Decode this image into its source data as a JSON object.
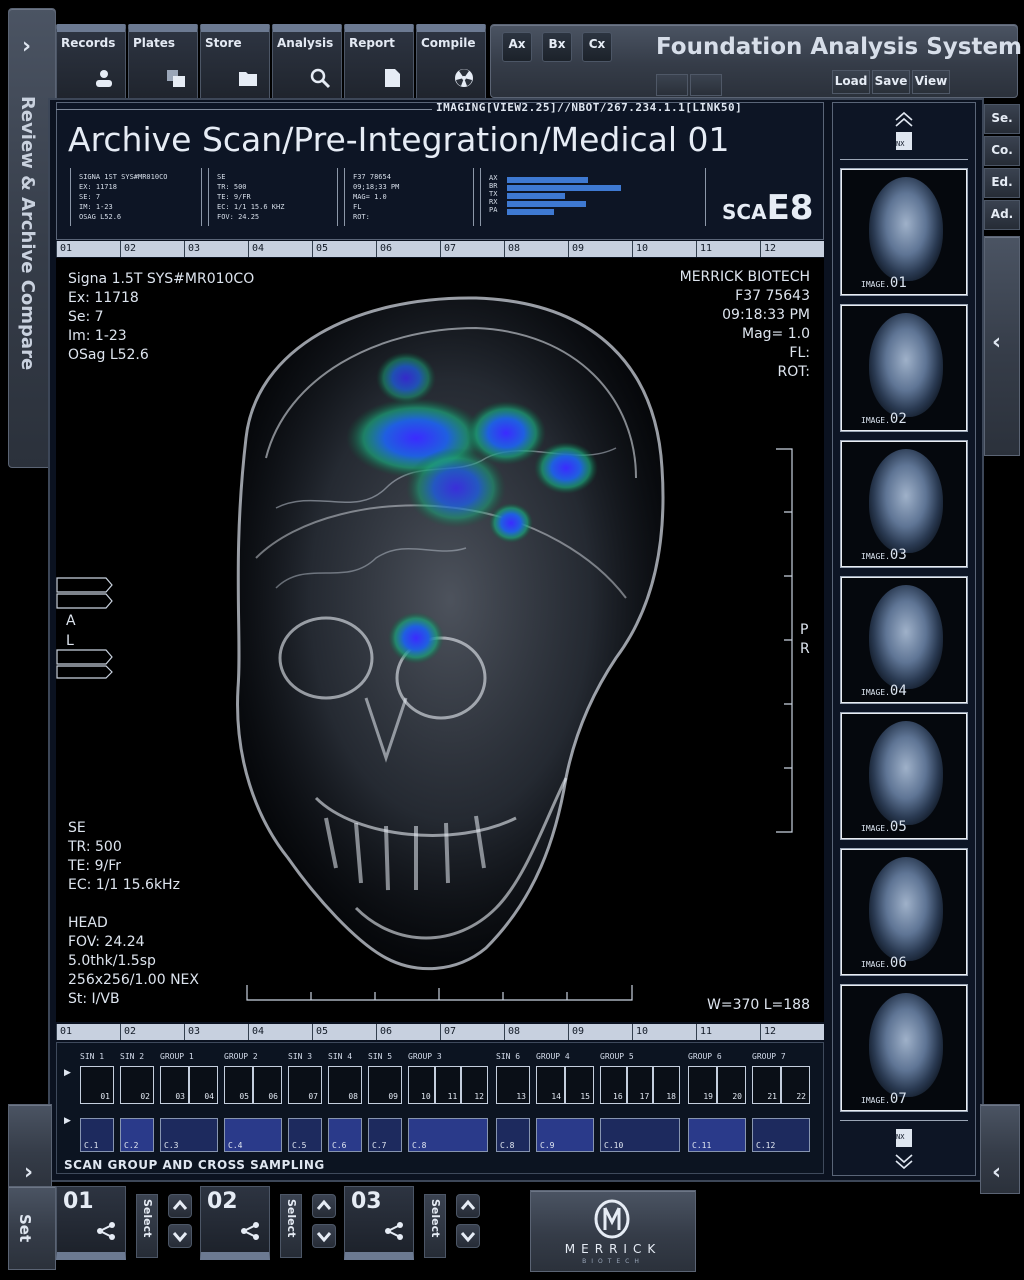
{
  "app_title": "Foundation Analysis System",
  "side_title": "Review & Archive Compare",
  "toolbar": [
    {
      "label": "Records",
      "icon": "user-icon"
    },
    {
      "label": "Plates",
      "icon": "plates-icon"
    },
    {
      "label": "Store",
      "icon": "folder-icon"
    },
    {
      "label": "Analysis",
      "icon": "magnifier-icon"
    },
    {
      "label": "Report",
      "icon": "document-icon"
    },
    {
      "label": "Compile",
      "icon": "radiation-icon"
    }
  ],
  "axis_buttons": [
    "Ax",
    "Bx",
    "Cx"
  ],
  "file_buttons": [
    "Load",
    "Save",
    "View"
  ],
  "right_side_buttons": [
    "Se.",
    "Co.",
    "Ed.",
    "Ad."
  ],
  "header": {
    "path": "IMAGING[VIEW2.25]//NBOT/267.234.1.1[LINK50]",
    "title": "Archive Scan/Pre-Integration/Medical 01",
    "block1": [
      "SIGNA 1ST SYS#MR010CO",
      "EX: 11718",
      "SE: 7",
      "IM: 1-23",
      "OSAG L52.6"
    ],
    "block2": [
      "SE",
      "TR: 500",
      "TE: 9/FR",
      "EC: 1/1 15.6 KHZ",
      "FOV: 24.25"
    ],
    "block3": [
      "F37 78654",
      "09;18;33 PM",
      "MAG= 1.0",
      "FL",
      "ROT:"
    ],
    "chart_labels": [
      "AX",
      "BR",
      "TX",
      "RX",
      "PA"
    ],
    "chart_values": [
      0.71,
      1.0,
      0.51,
      0.69,
      0.41
    ],
    "sca_label": "SCA",
    "sca_code": "E8"
  },
  "ruler_labels": [
    "01",
    "02",
    "03",
    "04",
    "05",
    "06",
    "07",
    "08",
    "09",
    "10",
    "11",
    "12"
  ],
  "overlay": {
    "top_left": [
      "Signa 1.5T SYS#MR010CO",
      "Ex: 11718",
      "Se: 7",
      "Im: 1-23",
      "OSag  L52.6"
    ],
    "top_right": [
      "MERRICK BIOTECH",
      "F37 75643",
      "09:18:33 PM",
      "Mag= 1.0",
      "FL:",
      "ROT:"
    ],
    "bottom_left": [
      "SE",
      "TR: 500",
      "TE: 9/Fr",
      "EC: 1/1 15.6kHz",
      "",
      "HEAD",
      "FOV: 24.24",
      "5.0thk/1.5sp",
      "256x256/1.00 NEX",
      "St: I/VB"
    ],
    "side_left": [
      "A",
      "L"
    ],
    "side_right": [
      "P",
      "R"
    ],
    "window_level": "W=370 L=188"
  },
  "thumbnails": [
    {
      "prefix": "IMAGE.",
      "num": "01"
    },
    {
      "prefix": "IMAGE.",
      "num": "02"
    },
    {
      "prefix": "IMAGE.",
      "num": "03"
    },
    {
      "prefix": "IMAGE.",
      "num": "04"
    },
    {
      "prefix": "IMAGE.",
      "num": "05"
    },
    {
      "prefix": "IMAGE.",
      "num": "06"
    },
    {
      "prefix": "IMAGE.",
      "num": "07"
    }
  ],
  "thumb_nav": "NX",
  "groups": [
    "SIN 1",
    "SIN 2",
    "GROUP 1",
    "GROUP 2",
    "SIN 3",
    "SIN 4",
    "SIN 5",
    "GROUP 3",
    "SIN 6",
    "GROUP 4",
    "GROUP 5",
    "GROUP 6",
    "GROUP 7"
  ],
  "cells": [
    "01",
    "02",
    "03",
    "04",
    "05",
    "06",
    "07",
    "08",
    "09",
    "10",
    "11",
    "12",
    "13",
    "14",
    "15",
    "16",
    "17",
    "18",
    "19",
    "20",
    "21",
    "22"
  ],
  "cross": [
    "C.1",
    "C.2",
    "C.3",
    "C.4",
    "C.5",
    "C.6",
    "C.7",
    "C.8",
    "C.8",
    "C.9",
    "C.10",
    "C.11",
    "C.12"
  ],
  "section_title": "SCAN GROUP AND CROSS SAMPLING",
  "bottom_tabs": [
    {
      "num": "01",
      "select": "Select"
    },
    {
      "num": "02",
      "select": "Select"
    },
    {
      "num": "03",
      "select": "Select"
    }
  ],
  "set_label": "Set",
  "brand": {
    "name": "MERRICK",
    "sub": "BIOTECH"
  }
}
